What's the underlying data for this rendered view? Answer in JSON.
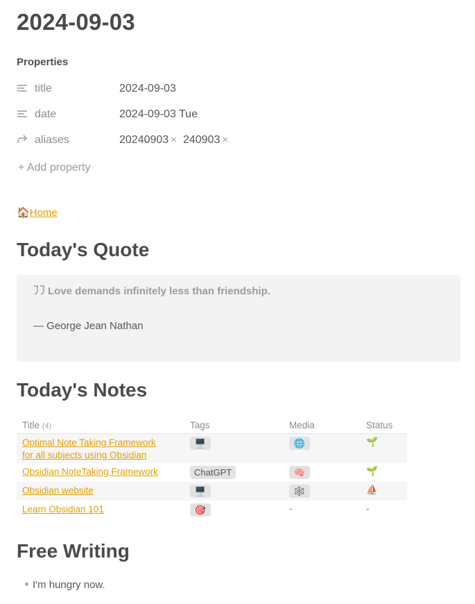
{
  "note": {
    "title": "2024-09-03"
  },
  "properties": {
    "heading": "Properties",
    "rows": [
      {
        "icon": "text-lines-icon",
        "key": "title",
        "value": "2024-09-03"
      },
      {
        "icon": "text-lines-icon",
        "key": "date",
        "value": "2024-09-03 Tue"
      },
      {
        "icon": "forward-arrow-icon",
        "key": "aliases",
        "values": [
          "20240903",
          "240903"
        ]
      }
    ],
    "alias_remove_glyph": "×",
    "add_label": "+ Add property"
  },
  "home": {
    "icon": "🏠",
    "label": "Home"
  },
  "quote_section": {
    "heading": "Today's Quote",
    "quote_icon": "quote-icon",
    "text": "Love demands infinitely less than friendship.",
    "author": "— George Jean Nathan"
  },
  "notes_section": {
    "heading": "Today's Notes",
    "columns": {
      "title": "Title",
      "count": "(4)",
      "tags": "Tags",
      "media": "Media",
      "status": "Status"
    },
    "rows": [
      {
        "title_line1": "Optimal Note Taking Framework ",
        "title_line2": "for all subjects using Obsidian",
        "tag": "🖥️",
        "media": "🌐",
        "status": "🌱"
      },
      {
        "title_line1": "Obsidian NoteTaking Framework",
        "tag": "ChatGPT",
        "media": "🧠",
        "status": "🌱"
      },
      {
        "title_line1": "Obsidian website",
        "tag": "🖥️",
        "media": "🕸️",
        "status": "⛵"
      },
      {
        "title_line1": "Learn Obsidian 101",
        "tag": "🎯",
        "media": "-",
        "status": "-"
      }
    ]
  },
  "free_writing": {
    "heading": "Free Writing",
    "items": [
      "I'm hungry now."
    ]
  }
}
